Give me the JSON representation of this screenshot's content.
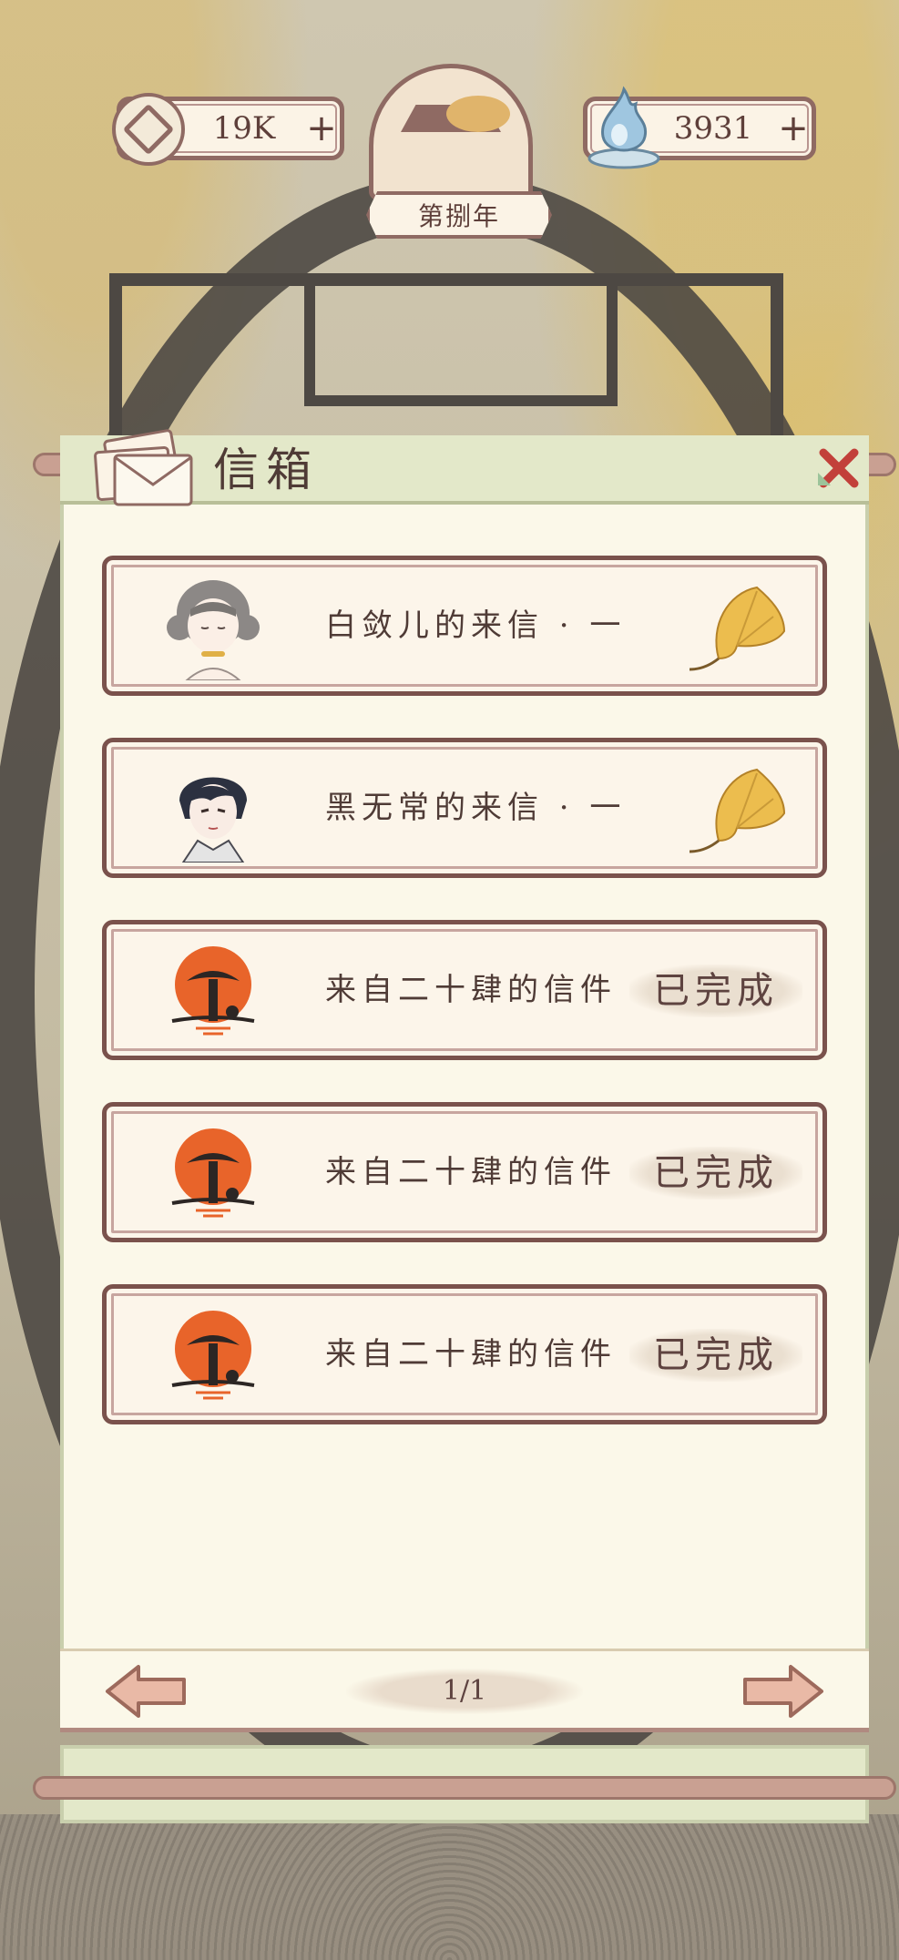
{
  "hud": {
    "coins": "19K",
    "coin_plus": "+",
    "souls": "3931",
    "soul_plus": "+",
    "year": "第捌年"
  },
  "mailbox": {
    "title": "信箱",
    "letters": [
      {
        "title": "白敛儿的来信 · 一",
        "status": "",
        "reward_icon": "ginkgo-leaf-icon",
        "avatar": "white-hair-girl-portrait"
      },
      {
        "title": "黑无常的来信 · 一",
        "status": "",
        "reward_icon": "ginkgo-leaf-icon",
        "avatar": "black-hair-man-portrait"
      },
      {
        "title": "来自二十肆的信件",
        "status": "已完成",
        "avatar": "ink-mushroom-sun-emblem"
      },
      {
        "title": "来自二十肆的信件",
        "status": "已完成",
        "avatar": "ink-mushroom-sun-emblem"
      },
      {
        "title": "来自二十肆的信件",
        "status": "已完成",
        "avatar": "ink-mushroom-sun-emblem"
      }
    ],
    "pagination": "1/1"
  },
  "colors": {
    "frame": "#7a524c",
    "parchment": "#fcf5ea",
    "header_green": "#e3e8c9",
    "ginkgo": "#e8b84a",
    "emblem_orange": "#e8642a"
  }
}
